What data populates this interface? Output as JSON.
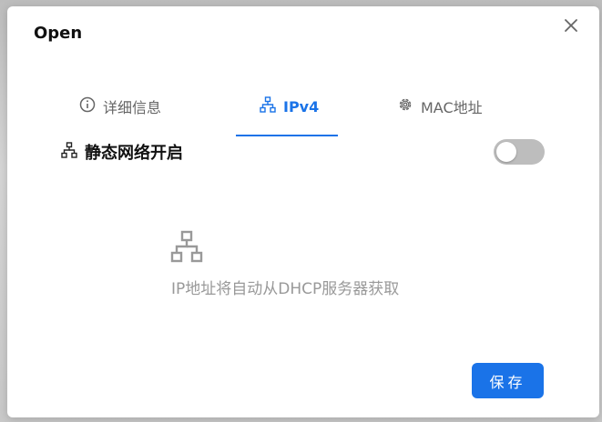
{
  "dialog": {
    "title": "Open",
    "close_icon": "close-icon"
  },
  "tabs": [
    {
      "label": "详细信息",
      "icon": "info-icon",
      "active": false
    },
    {
      "label": "IPv4",
      "icon": "network-icon",
      "active": true
    },
    {
      "label": "MAC地址",
      "icon": "gear-icon",
      "active": false
    }
  ],
  "static_network": {
    "label": "静态网络开启",
    "icon": "network-icon",
    "enabled": false
  },
  "empty_state": {
    "icon": "network-icon",
    "message": "IP地址将自动从DHCP服务器获取"
  },
  "footer": {
    "save_label": "保存"
  },
  "colors": {
    "accent": "#1a73e8",
    "toggle_off": "#bdbdbd",
    "muted_text": "#999999"
  }
}
